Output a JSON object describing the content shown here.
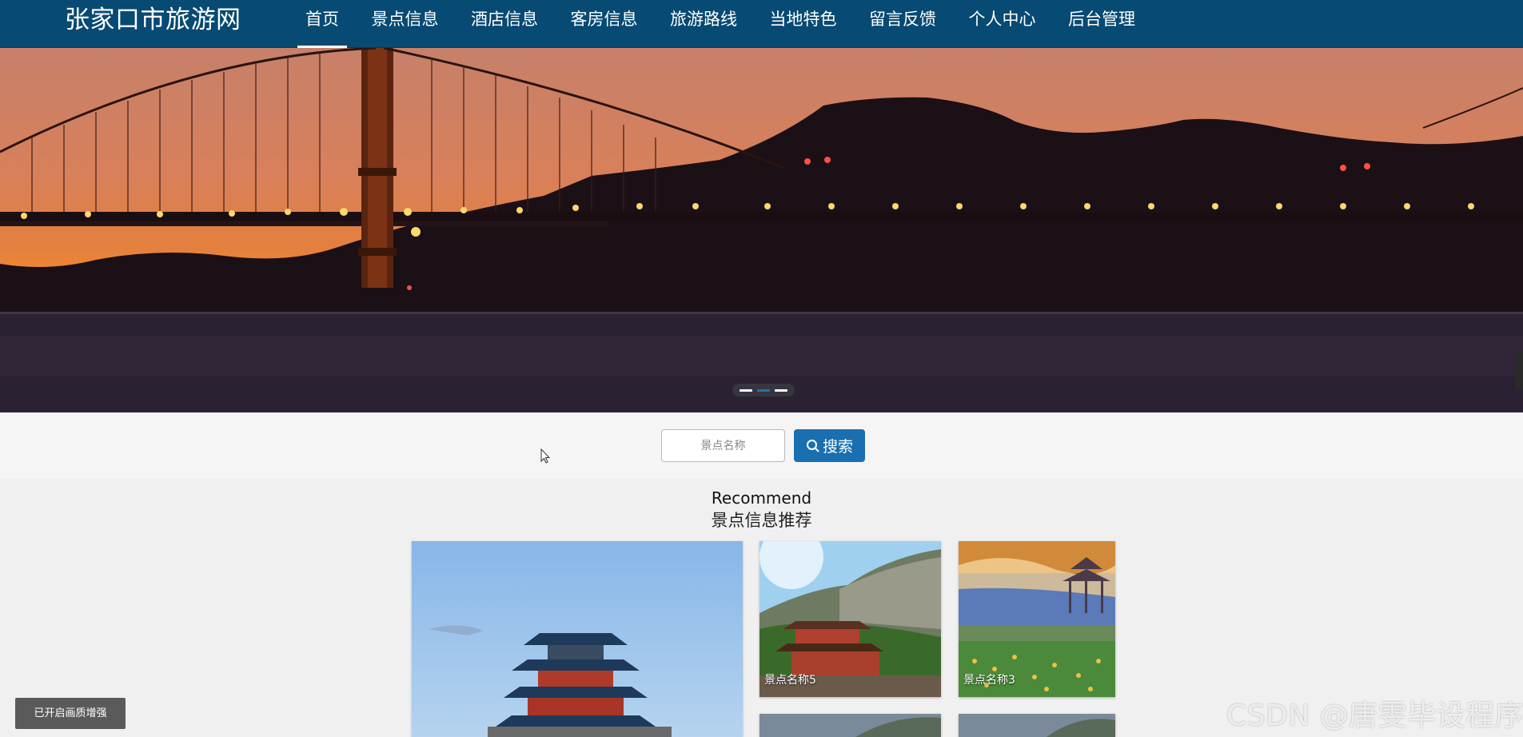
{
  "nav": {
    "brand": "张家口市旅游网",
    "items": [
      {
        "label": "首页",
        "active": true
      },
      {
        "label": "景点信息"
      },
      {
        "label": "酒店信息"
      },
      {
        "label": "客房信息"
      },
      {
        "label": "旅游路线"
      },
      {
        "label": "当地特色"
      },
      {
        "label": "留言反馈"
      },
      {
        "label": "个人中心"
      },
      {
        "label": "后台管理"
      }
    ]
  },
  "banner": {
    "slide_count": 3,
    "active_slide": 2
  },
  "search": {
    "placeholder": "景点名称",
    "button_label": "搜索"
  },
  "recommend": {
    "title": "Recommend",
    "subtitle": "景点信息推荐",
    "cards": [
      {
        "caption": ""
      },
      {
        "caption": "景点名称5"
      },
      {
        "caption": "景点名称3"
      },
      {
        "caption": ""
      },
      {
        "caption": ""
      }
    ]
  },
  "overlay": {
    "quality_badge": "已开启画质增强",
    "watermark": "CSDN @唐雯毕设程序"
  },
  "colors": {
    "nav_bg": "#074a73",
    "search_button": "#1a6fb0",
    "page_bg": "#f0f0f0"
  }
}
